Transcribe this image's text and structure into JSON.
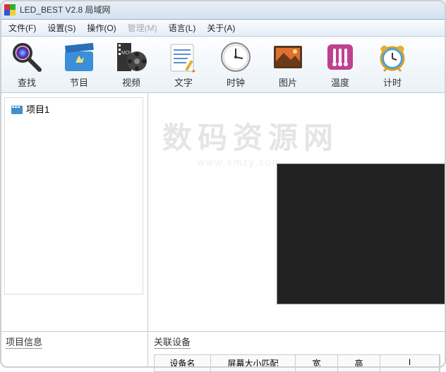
{
  "titlebar": {
    "app_title": "LED_BEST V2.8    局域网"
  },
  "menubar": {
    "file": "文件(F)",
    "settings": "设置(S)",
    "operation": "操作(O)",
    "manage": "管理(M)",
    "language": "语言(L)",
    "about": "关于(A)"
  },
  "toolbar": {
    "search": "查找",
    "program": "节目",
    "video": "视频",
    "text": "文字",
    "clock": "时钟",
    "image": "图片",
    "temperature": "温度",
    "timer": "计时"
  },
  "tree": {
    "item1": "项目1"
  },
  "bottom": {
    "project_info": "项目信息",
    "related_devices": "关联设备",
    "th_name": "设备名",
    "th_match": "屏幕大小匹配",
    "th_w": "宽",
    "th_h": "高"
  },
  "watermark": {
    "main": "数码资源网",
    "sub": "www.smzy.com"
  }
}
